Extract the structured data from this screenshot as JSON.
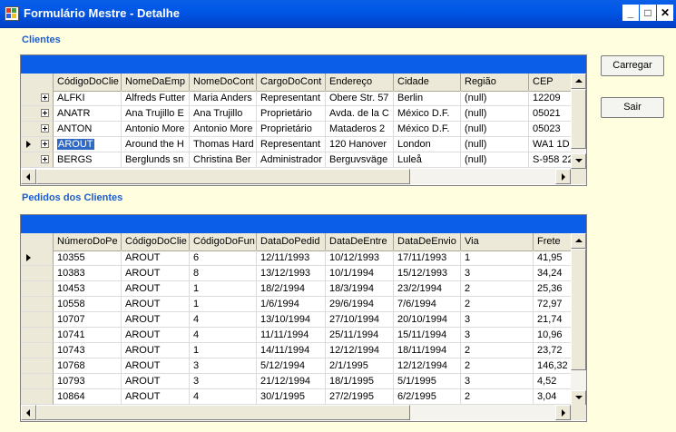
{
  "window": {
    "title": "Formulário Mestre - Detalhe",
    "min_glyph": "_",
    "max_glyph": "□",
    "close_glyph": "✕"
  },
  "clientes": {
    "label": "Clientes",
    "columns": [
      "CódigoDoClie",
      "NomeDaEmp",
      "NomeDoCont",
      "CargoDoCont",
      "Endereço",
      "Cidade",
      "Região",
      "CEP"
    ],
    "rows": [
      [
        "ALFKI",
        "Alfreds Futter",
        "Maria Anders",
        "Representant",
        "Obere Str. 57",
        "Berlin",
        "(null)",
        "12209"
      ],
      [
        "ANATR",
        "Ana Trujillo E",
        "Ana Trujillo",
        "Proprietário",
        "Avda. de la C",
        "México D.F.",
        "(null)",
        "05021"
      ],
      [
        "ANTON",
        "Antonio More",
        "Antonio More",
        "Proprietário",
        "Mataderos  2",
        "México D.F.",
        "(null)",
        "05023"
      ],
      [
        "AROUT",
        "Around the H",
        "Thomas Hard",
        "Representant",
        "120 Hanover",
        "London",
        "(null)",
        "WA1 1D"
      ],
      [
        "BERGS",
        "Berglunds sn",
        "Christina Ber",
        "Administrador",
        "Berguvsväge",
        "Luleå",
        "(null)",
        "S-958 22"
      ]
    ],
    "current_row": 3
  },
  "pedidos": {
    "label": "Pedidos dos Clientes",
    "columns": [
      "NúmeroDoPe",
      "CódigoDoClie",
      "CódigoDoFun",
      "DataDoPedid",
      "DataDeEntre",
      "DataDeEnvio",
      "Via",
      "Frete"
    ],
    "rows": [
      [
        "10355",
        "AROUT",
        "6",
        "12/11/1993",
        "10/12/1993",
        "17/11/1993",
        "1",
        "41,95"
      ],
      [
        "10383",
        "AROUT",
        "8",
        "13/12/1993",
        "10/1/1994",
        "15/12/1993",
        "3",
        "34,24"
      ],
      [
        "10453",
        "AROUT",
        "1",
        "18/2/1994",
        "18/3/1994",
        "23/2/1994",
        "2",
        "25,36"
      ],
      [
        "10558",
        "AROUT",
        "1",
        "1/6/1994",
        "29/6/1994",
        "7/6/1994",
        "2",
        "72,97"
      ],
      [
        "10707",
        "AROUT",
        "4",
        "13/10/1994",
        "27/10/1994",
        "20/10/1994",
        "3",
        "21,74"
      ],
      [
        "10741",
        "AROUT",
        "4",
        "11/11/1994",
        "25/11/1994",
        "15/11/1994",
        "3",
        "10,96"
      ],
      [
        "10743",
        "AROUT",
        "1",
        "14/11/1994",
        "12/12/1994",
        "18/11/1994",
        "2",
        "23,72"
      ],
      [
        "10768",
        "AROUT",
        "3",
        "5/12/1994",
        "2/1/1995",
        "12/12/1994",
        "2",
        "146,32"
      ],
      [
        "10793",
        "AROUT",
        "3",
        "21/12/1994",
        "18/1/1995",
        "5/1/1995",
        "3",
        "4,52"
      ],
      [
        "10864",
        "AROUT",
        "4",
        "30/1/1995",
        "27/2/1995",
        "6/2/1995",
        "2",
        "3,04"
      ]
    ],
    "current_row": 0
  },
  "buttons": {
    "carregar": "Carregar",
    "sair": "Sair"
  },
  "colors": {
    "titlebar": "#0a5ee8",
    "section_label": "#1a5cd6",
    "form_background": "#ffffe0",
    "selection": "#316ac5"
  }
}
